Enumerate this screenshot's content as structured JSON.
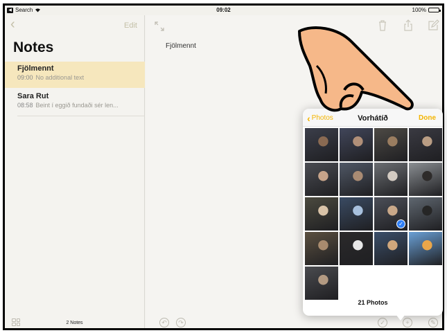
{
  "status_bar": {
    "back_app": "Search",
    "time": "09:02",
    "battery": "100%"
  },
  "sidebar": {
    "edit_label": "Edit",
    "title": "Notes",
    "notes": [
      {
        "title": "Fjölmennt",
        "time": "09:00",
        "preview": "No additional text",
        "selected": true
      },
      {
        "title": "Sara Rut",
        "time": "08:58",
        "preview": "Beint í eggið fundaði sér len...",
        "selected": false
      }
    ],
    "footer_count": "2 Notes"
  },
  "main": {
    "note_text": "Fjölmennt"
  },
  "photo_picker": {
    "back_label": "Photos",
    "album_title": "Vorhátíð",
    "done_label": "Done",
    "photo_count_label": "21 Photos",
    "selected_index": 10,
    "thumbnails": [
      {
        "bg": "#3b3e4a",
        "accent": "#8a6a52"
      },
      {
        "bg": "#41465a",
        "accent": "#b08f78"
      },
      {
        "bg": "#4d4a45",
        "accent": "#9a7d60"
      },
      {
        "bg": "#3a3a42",
        "accent": "#b99d84"
      },
      {
        "bg": "#4a4c52",
        "accent": "#c7a48a"
      },
      {
        "bg": "#505866",
        "accent": "#a98b73"
      },
      {
        "bg": "#6b6e72",
        "accent": "#d3cbc2"
      },
      {
        "bg": "#8a8e92",
        "accent": "#2e2b2a"
      },
      {
        "bg": "#4b4a3f",
        "accent": "#d9c3a8"
      },
      {
        "bg": "#3a4b63",
        "accent": "#a7c0dd"
      },
      {
        "bg": "#4c4f58",
        "accent": "#c9a889"
      },
      {
        "bg": "#5f6770",
        "accent": "#262626"
      },
      {
        "bg": "#5b5040",
        "accent": "#a98b6e"
      },
      {
        "bg": "#2b2a2b",
        "accent": "#e7e7e7"
      },
      {
        "bg": "#3b4f6a",
        "accent": "#d0a77c"
      },
      {
        "bg": "#6aa0d6",
        "accent": "#e9a64a"
      },
      {
        "bg": "#4a4b4f",
        "accent": "#b39a82"
      }
    ]
  },
  "colors": {
    "accent": "#f3b400",
    "selection_note": "#f6e7bd",
    "check_blue": "#2f7ff6"
  }
}
